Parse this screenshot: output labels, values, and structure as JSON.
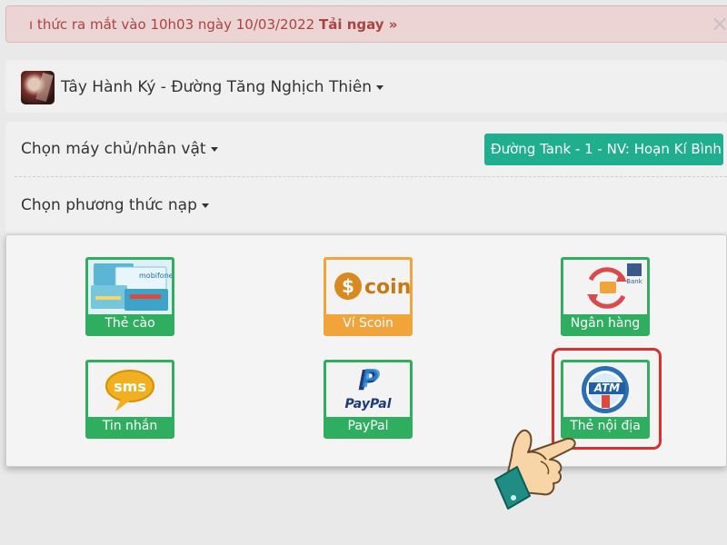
{
  "banner": {
    "text": "ı thức ra mắt vào 10h03 ngày 10/03/2022 ",
    "link": "Tải ngay »",
    "close": "×"
  },
  "game": {
    "title": "Tây Hành Ký - Đường Tăng Nghịch Thiên"
  },
  "server": {
    "label": "Chọn máy chủ/nhân vật",
    "selected": "Đường Tank - 1 - NV: Hoạn Kí Bình"
  },
  "payment": {
    "label": "Chọn phương thức nạp",
    "methods": [
      {
        "label": "Thẻ cào",
        "logo_text": "mobifone"
      },
      {
        "label": "Ví Scoin",
        "logo_text": "coin"
      },
      {
        "label": "Ngân hàng",
        "logo_text": "Bank"
      },
      {
        "label": "Tin nhắn",
        "logo_text": "sms"
      },
      {
        "label": "PayPal",
        "logo_text": "PayPal"
      },
      {
        "label": "Thẻ nội địa",
        "logo_text": "ATM"
      }
    ]
  },
  "colors": {
    "accent_green": "#2fae5f",
    "server_button": "#1fae8e",
    "scoin_orange": "#f0a43a",
    "highlight_red": "#d9312b",
    "banner_text": "#a94442"
  },
  "icons": {
    "banner_close": "close-icon",
    "dropdown": "caret-down-icon",
    "pointer": "pointing-hand-icon"
  }
}
